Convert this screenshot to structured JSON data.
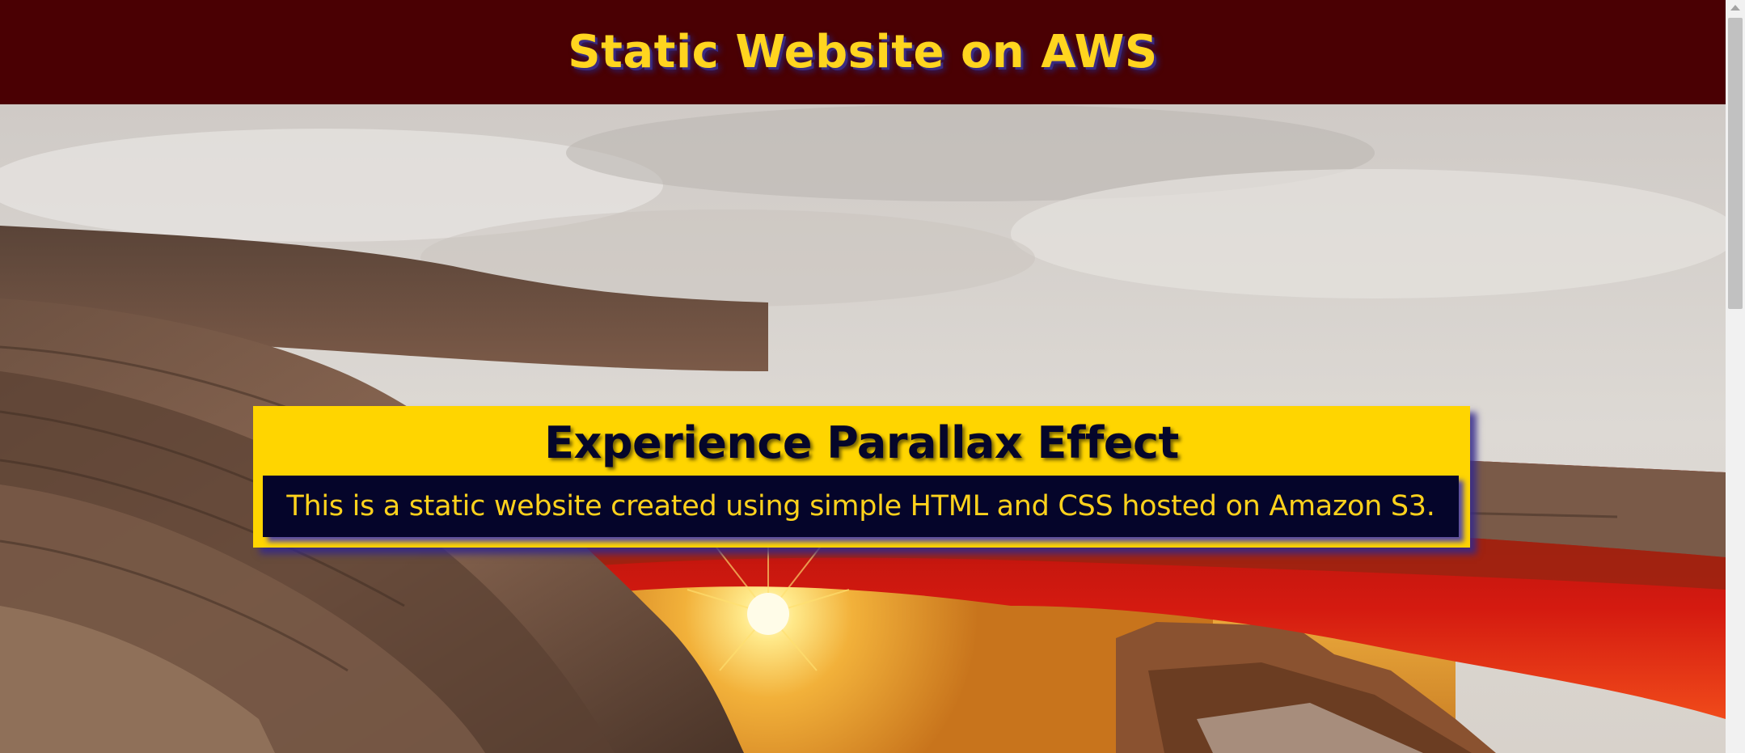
{
  "header": {
    "title": "Static Website on AWS"
  },
  "hero": {
    "image_icon": "desert-arch-sunrise-image",
    "heading": "Experience Parallax Effect",
    "description": "This is a static website created using simple HTML and CSS hosted on Amazon S3."
  },
  "colors": {
    "header_bg": "#4a0003",
    "title_color": "#ffd51f",
    "card_bg": "#ffd500",
    "tagline_bg": "#05052a",
    "shadow": "#3a2a80"
  }
}
